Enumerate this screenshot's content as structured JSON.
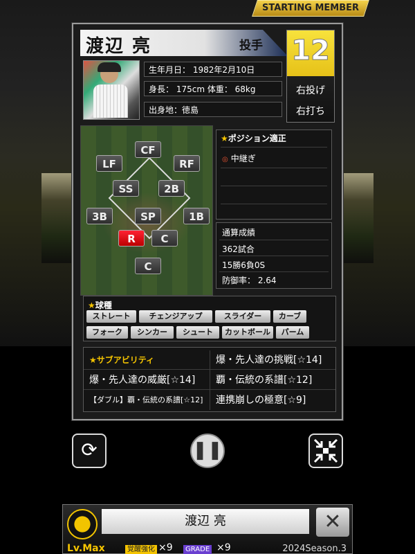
{
  "banner": "STARTING MEMBER",
  "player": {
    "name": "渡辺 亮",
    "position": "投手",
    "number": "12",
    "throws": "右投げ",
    "bats": "右打ち",
    "birth": "生年月日： 1982年2月10日",
    "body": "身長： 175cm 体重： 68kg",
    "hometown": "出身地：徳島"
  },
  "field_positions": {
    "cf": "CF",
    "lf": "LF",
    "rf": "RF",
    "ss": "SS",
    "b2": "2B",
    "b3": "3B",
    "sp": "SP",
    "b1": "1B",
    "rp": "R",
    "c1": "C",
    "c2": "C"
  },
  "aptitude": {
    "title": "ポジション適正",
    "item": "中継ぎ"
  },
  "stats": {
    "title": "通算成績",
    "games": "362試合",
    "record": "15勝6負0S",
    "era": "防御率： 2.64"
  },
  "pitches": {
    "title": "球種",
    "items": [
      "ストレート",
      "チェンジアップ",
      "スライダー",
      "カーブ",
      "フォーク",
      "シンカー",
      "シュート",
      "カットボール",
      "パーム"
    ]
  },
  "abilities": {
    "title": "サブアビリティ",
    "items": [
      "爆・先人達の挑戦[☆14]",
      "爆・先人達の威厳[☆14]",
      "覇・伝統の系譜[☆12]",
      "【ダブル】覇・伝統の系譜[☆12]",
      "連携崩しの極意[☆9]"
    ]
  },
  "controls": {
    "refresh_icon": "refresh-icon",
    "pause_icon": "pause-icon",
    "shrink_icon": "shrink-icon"
  },
  "bottom": {
    "team_logo": "HANSHIN Tigers",
    "name": "渡辺 亮",
    "close": "✕",
    "level": "Lv.Max",
    "awakening_label": "覚醒強化",
    "awakening_mult": "×9",
    "grade_label": "GRADE",
    "grade_mult": "×9",
    "season": "2024Season.3"
  }
}
